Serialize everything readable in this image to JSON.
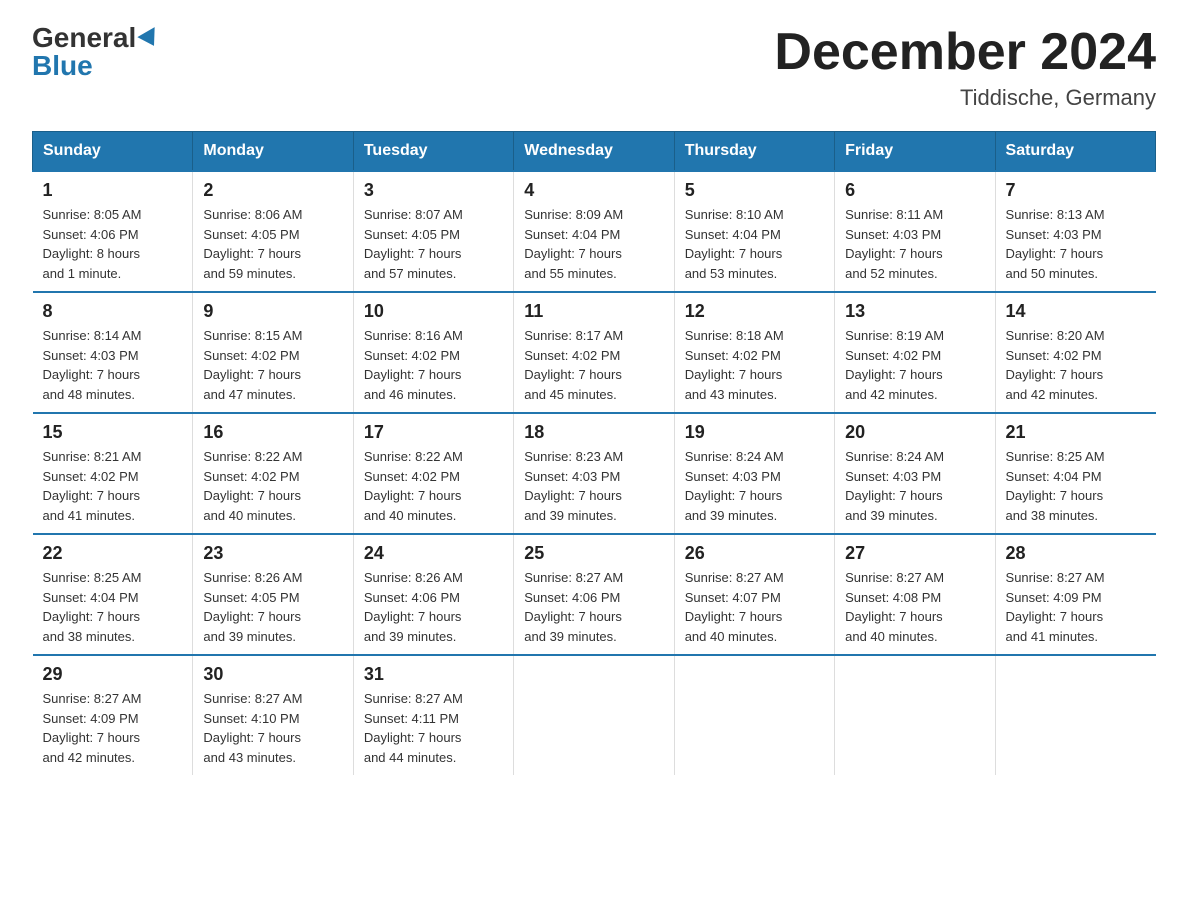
{
  "logo": {
    "general": "General",
    "blue": "Blue"
  },
  "title": "December 2024",
  "location": "Tiddische, Germany",
  "days_of_week": [
    "Sunday",
    "Monday",
    "Tuesday",
    "Wednesday",
    "Thursday",
    "Friday",
    "Saturday"
  ],
  "weeks": [
    [
      {
        "day": "1",
        "sunrise": "8:05 AM",
        "sunset": "4:06 PM",
        "daylight": "8 hours and 1 minute."
      },
      {
        "day": "2",
        "sunrise": "8:06 AM",
        "sunset": "4:05 PM",
        "daylight": "7 hours and 59 minutes."
      },
      {
        "day": "3",
        "sunrise": "8:07 AM",
        "sunset": "4:05 PM",
        "daylight": "7 hours and 57 minutes."
      },
      {
        "day": "4",
        "sunrise": "8:09 AM",
        "sunset": "4:04 PM",
        "daylight": "7 hours and 55 minutes."
      },
      {
        "day": "5",
        "sunrise": "8:10 AM",
        "sunset": "4:04 PM",
        "daylight": "7 hours and 53 minutes."
      },
      {
        "day": "6",
        "sunrise": "8:11 AM",
        "sunset": "4:03 PM",
        "daylight": "7 hours and 52 minutes."
      },
      {
        "day": "7",
        "sunrise": "8:13 AM",
        "sunset": "4:03 PM",
        "daylight": "7 hours and 50 minutes."
      }
    ],
    [
      {
        "day": "8",
        "sunrise": "8:14 AM",
        "sunset": "4:03 PM",
        "daylight": "7 hours and 48 minutes."
      },
      {
        "day": "9",
        "sunrise": "8:15 AM",
        "sunset": "4:02 PM",
        "daylight": "7 hours and 47 minutes."
      },
      {
        "day": "10",
        "sunrise": "8:16 AM",
        "sunset": "4:02 PM",
        "daylight": "7 hours and 46 minutes."
      },
      {
        "day": "11",
        "sunrise": "8:17 AM",
        "sunset": "4:02 PM",
        "daylight": "7 hours and 45 minutes."
      },
      {
        "day": "12",
        "sunrise": "8:18 AM",
        "sunset": "4:02 PM",
        "daylight": "7 hours and 43 minutes."
      },
      {
        "day": "13",
        "sunrise": "8:19 AM",
        "sunset": "4:02 PM",
        "daylight": "7 hours and 42 minutes."
      },
      {
        "day": "14",
        "sunrise": "8:20 AM",
        "sunset": "4:02 PM",
        "daylight": "7 hours and 42 minutes."
      }
    ],
    [
      {
        "day": "15",
        "sunrise": "8:21 AM",
        "sunset": "4:02 PM",
        "daylight": "7 hours and 41 minutes."
      },
      {
        "day": "16",
        "sunrise": "8:22 AM",
        "sunset": "4:02 PM",
        "daylight": "7 hours and 40 minutes."
      },
      {
        "day": "17",
        "sunrise": "8:22 AM",
        "sunset": "4:02 PM",
        "daylight": "7 hours and 40 minutes."
      },
      {
        "day": "18",
        "sunrise": "8:23 AM",
        "sunset": "4:03 PM",
        "daylight": "7 hours and 39 minutes."
      },
      {
        "day": "19",
        "sunrise": "8:24 AM",
        "sunset": "4:03 PM",
        "daylight": "7 hours and 39 minutes."
      },
      {
        "day": "20",
        "sunrise": "8:24 AM",
        "sunset": "4:03 PM",
        "daylight": "7 hours and 39 minutes."
      },
      {
        "day": "21",
        "sunrise": "8:25 AM",
        "sunset": "4:04 PM",
        "daylight": "7 hours and 38 minutes."
      }
    ],
    [
      {
        "day": "22",
        "sunrise": "8:25 AM",
        "sunset": "4:04 PM",
        "daylight": "7 hours and 38 minutes."
      },
      {
        "day": "23",
        "sunrise": "8:26 AM",
        "sunset": "4:05 PM",
        "daylight": "7 hours and 39 minutes."
      },
      {
        "day": "24",
        "sunrise": "8:26 AM",
        "sunset": "4:06 PM",
        "daylight": "7 hours and 39 minutes."
      },
      {
        "day": "25",
        "sunrise": "8:27 AM",
        "sunset": "4:06 PM",
        "daylight": "7 hours and 39 minutes."
      },
      {
        "day": "26",
        "sunrise": "8:27 AM",
        "sunset": "4:07 PM",
        "daylight": "7 hours and 40 minutes."
      },
      {
        "day": "27",
        "sunrise": "8:27 AM",
        "sunset": "4:08 PM",
        "daylight": "7 hours and 40 minutes."
      },
      {
        "day": "28",
        "sunrise": "8:27 AM",
        "sunset": "4:09 PM",
        "daylight": "7 hours and 41 minutes."
      }
    ],
    [
      {
        "day": "29",
        "sunrise": "8:27 AM",
        "sunset": "4:09 PM",
        "daylight": "7 hours and 42 minutes."
      },
      {
        "day": "30",
        "sunrise": "8:27 AM",
        "sunset": "4:10 PM",
        "daylight": "7 hours and 43 minutes."
      },
      {
        "day": "31",
        "sunrise": "8:27 AM",
        "sunset": "4:11 PM",
        "daylight": "7 hours and 44 minutes."
      },
      null,
      null,
      null,
      null
    ]
  ],
  "labels": {
    "sunrise": "Sunrise:",
    "sunset": "Sunset:",
    "daylight": "Daylight:"
  }
}
